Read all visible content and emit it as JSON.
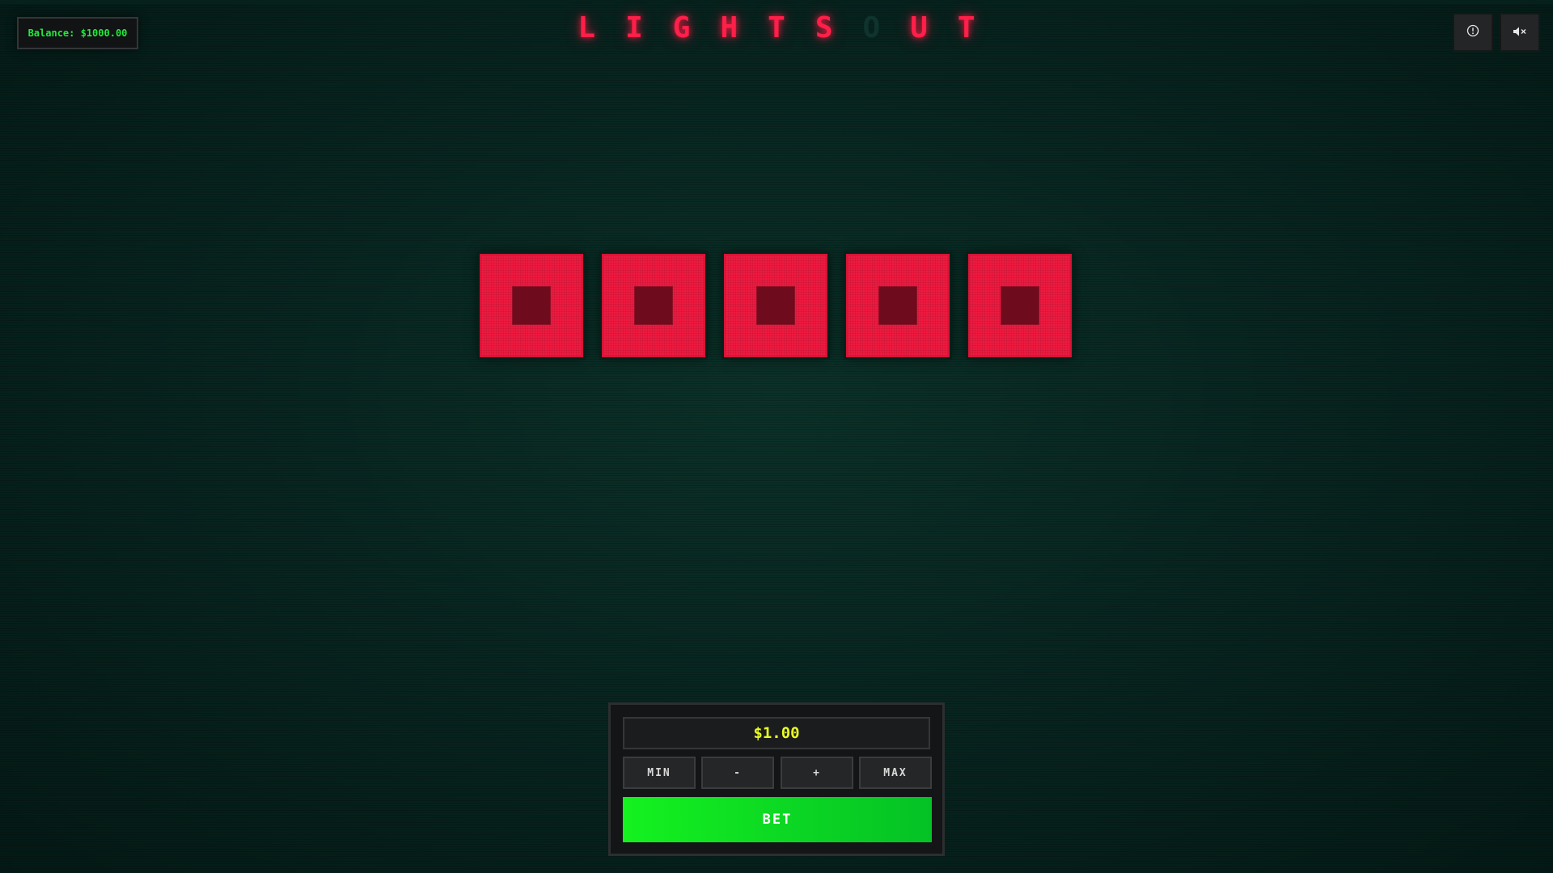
{
  "balance": {
    "text": "Balance: $1000.00",
    "color": "#22e83b"
  },
  "title": {
    "chars": [
      "L",
      "I",
      "G",
      "H",
      "T",
      "S",
      "O",
      "U",
      "T"
    ],
    "glow_color": "#ff1f48",
    "unlit_letter": "O"
  },
  "header_buttons": {
    "info_icon": "info-icon",
    "mute_icon": "speaker-muted-icon"
  },
  "lights": {
    "count": 5,
    "lit_color": "#ef1a40",
    "core_color": "#6e0b1d",
    "states": [
      "on",
      "on",
      "on",
      "on",
      "on"
    ]
  },
  "bet_panel": {
    "amount": "$1.00",
    "amount_color": "#eaff22",
    "buttons": {
      "min": "MIN",
      "minus": "-",
      "plus": "+",
      "max": "MAX"
    },
    "bet_label": "BET",
    "bet_color": "#12e624"
  }
}
